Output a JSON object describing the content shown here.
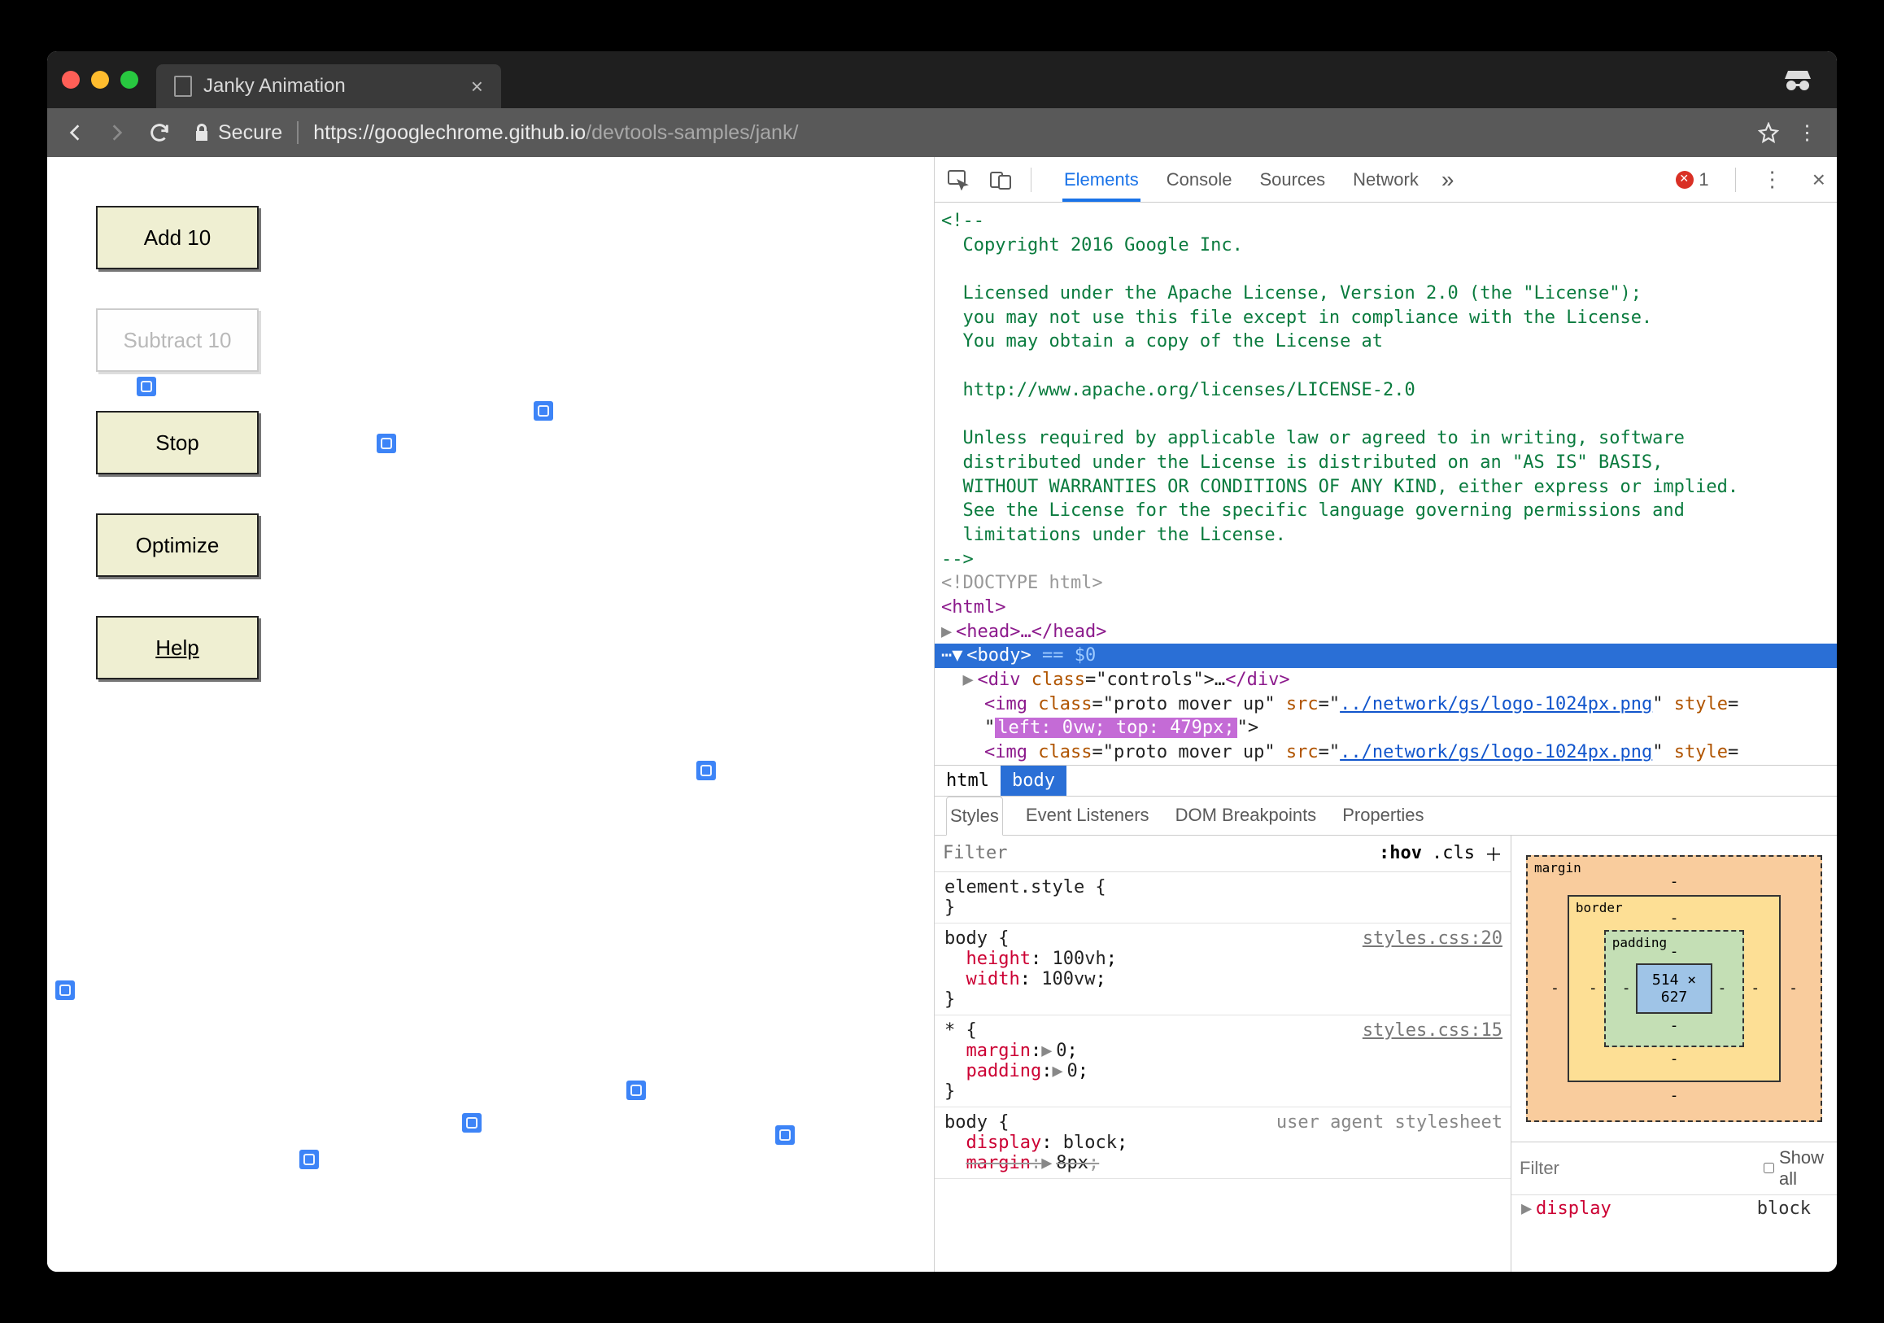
{
  "tab": {
    "title": "Janky Animation"
  },
  "address": {
    "secure": "Secure",
    "scheme": "https://",
    "host": "googlechrome.github.io",
    "path": "/devtools-samples/jank/"
  },
  "buttons": {
    "add": "Add 10",
    "subtract": "Subtract 10",
    "stop": "Stop",
    "optimize": "Optimize",
    "help": "Help"
  },
  "devtools": {
    "tabs": [
      "Elements",
      "Console",
      "Sources",
      "Network"
    ],
    "error_count": "1",
    "comment": {
      "l1": "<!--",
      "l2": "  Copyright 2016 Google Inc.",
      "l3": "  Licensed under the Apache License, Version 2.0 (the \"License\");",
      "l4": "  you may not use this file except in compliance with the License.",
      "l5": "  You may obtain a copy of the License at",
      "l6": "  http://www.apache.org/licenses/LICENSE-2.0",
      "l7": "  Unless required by applicable law or agreed to in writing, software",
      "l8": "  distributed under the License is distributed on an \"AS IS\" BASIS,",
      "l9": "  WITHOUT WARRANTIES OR CONDITIONS OF ANY KIND, either express or implied.",
      "l10": "  See the License for the specific language governing permissions and",
      "l11": "  limitations under the License.",
      "l12": "-->"
    },
    "dom": {
      "doctype": "<!DOCTYPE html>",
      "html_open": "<html>",
      "head": "<head>…</head>",
      "body_sel": "<body> == $0",
      "controls": "<div class=\"controls\">…</div>",
      "img1_a": "<img class=\"proto mover up\" src=\"",
      "img1_src": "../network/gs/logo-1024px.png",
      "img1_b": "\" style=",
      "img1_style": "left: 0vw; top: 479px;",
      "img1_c": "\">",
      "img2_a": "<img class=\"proto mover up\" src=\"",
      "img2_src": "../network/gs/logo-1024px.png",
      "img2_b": "\" style="
    },
    "crumbs": [
      "html",
      "body"
    ],
    "subtabs": [
      "Styles",
      "Event Listeners",
      "DOM Breakpoints",
      "Properties"
    ],
    "filter_placeholder": "Filter",
    "hov": ":hov",
    "cls": ".cls",
    "rules": {
      "r0": "element.style {",
      "r1_sel": "body {",
      "r1_src": "styles.css:20",
      "r1_p1": "height",
      "r1_v1": "100vh",
      "r1_p2": "width",
      "r1_v2": "100vw",
      "r2_sel": "* {",
      "r2_src": "styles.css:15",
      "r2_p1": "margin",
      "r2_v1": "0",
      "r2_p2": "padding",
      "r2_v2": "0",
      "r3_sel": "body {",
      "r3_ua": "user agent stylesheet",
      "r3_p1": "display",
      "r3_v1": "block",
      "r3_p2": "margin",
      "r3_v2": "8px"
    },
    "boxmodel": {
      "margin": "margin",
      "border": "border",
      "padding": "padding",
      "dash": "-",
      "size": "514 × 627"
    },
    "computed": {
      "filter_placeholder": "Filter",
      "showall": "Show all",
      "p1": "display",
      "v1": "block"
    }
  }
}
